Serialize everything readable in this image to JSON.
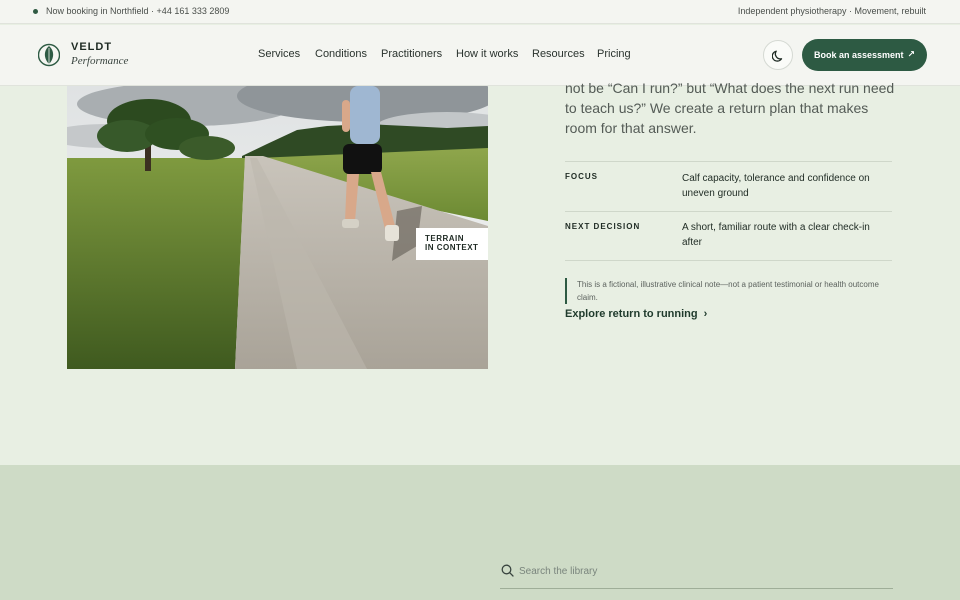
{
  "topbar": {
    "booking": "Now booking in Northfield · +44 161 333 2809",
    "tagline": "Independent physiotherapy · Movement, rebuilt"
  },
  "brand": {
    "name": "VELDT",
    "sub": "Performance"
  },
  "nav": [
    "Services",
    "Conditions",
    "Practitioners",
    "How it works",
    "Resources",
    "Pricing"
  ],
  "header": {
    "cta": "Book an assessment"
  },
  "photo": {
    "tag_line1": "TERRAIN",
    "tag_line2": "IN CONTEXT"
  },
  "story": {
    "lede": "not be “Can I run?” but “What does the next run need to teach us?” We create a return plan that makes room for that answer.",
    "rows": [
      {
        "key": "FOCUS",
        "value": "Calf capacity, tolerance and confidence on uneven ground"
      },
      {
        "key": "NEXT DECISION",
        "value": "A short, familiar route with a clear check-in after"
      }
    ],
    "note": "This is a fictional, illustrative clinical note—not a patient testimonial or health outcome claim.",
    "link": "Explore return to running"
  },
  "library": {
    "placeholder": "Search the library"
  },
  "colors": {
    "accent": "#2d5a43",
    "page": "#e8efe3",
    "lower": "#cedbc6"
  }
}
